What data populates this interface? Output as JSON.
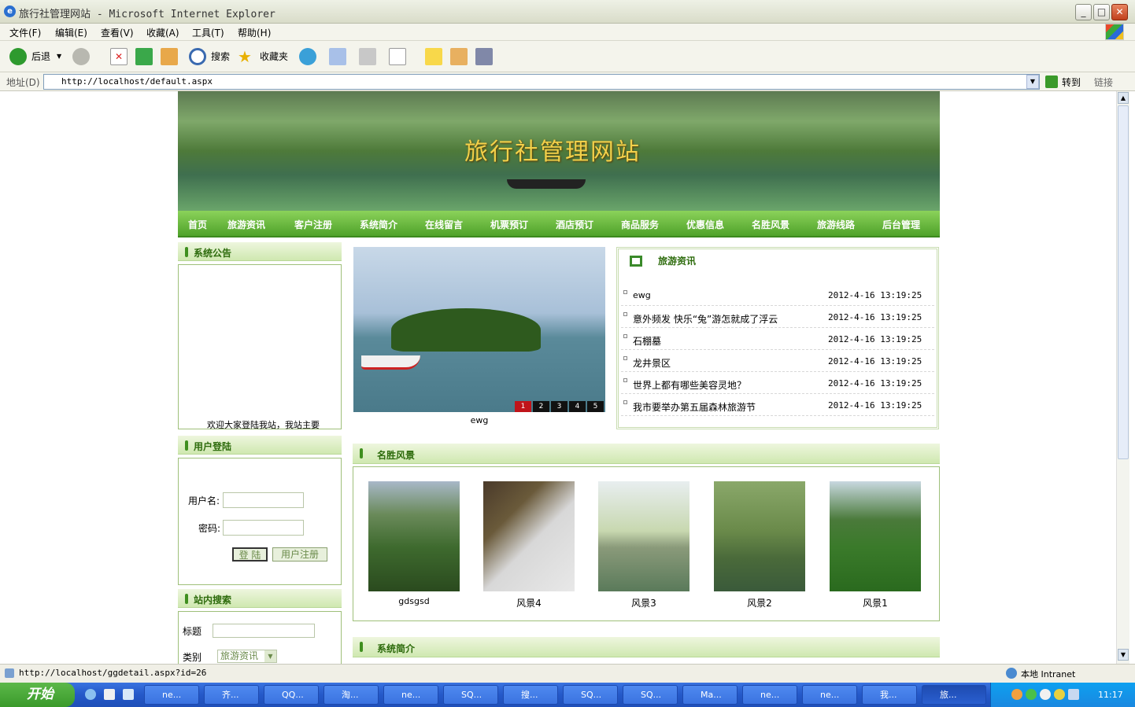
{
  "window": {
    "title": "旅行社管理网站 - Microsoft Internet Explorer",
    "minimize": "_",
    "maximize": "□",
    "close": "✕"
  },
  "menu": [
    "文件(F)",
    "编辑(E)",
    "查看(V)",
    "收藏(A)",
    "工具(T)",
    "帮助(H)"
  ],
  "toolbar": {
    "back": "后退",
    "search": "搜索",
    "favorites": "收藏夹"
  },
  "address": {
    "label": "地址(D)",
    "url": "http://localhost/default.aspx",
    "go": "转到",
    "links": "链接"
  },
  "site": {
    "banner_title": "旅行社管理网站",
    "nav": [
      "首页",
      "旅游资讯",
      "客户注册",
      "系统简介",
      "在线留言",
      "机票预订",
      "酒店预订",
      "商品服务",
      "优惠信息",
      "名胜风景",
      "旅游线路",
      "后台管理"
    ],
    "notice": {
      "title": "系统公告",
      "marquee": "欢迎大家登陆我站，我站主要"
    },
    "login": {
      "title": "用户登陆",
      "user_label": "用户名:",
      "pass_label": "密码:",
      "login_btn": "登 陆",
      "register_btn": "用户注册"
    },
    "search": {
      "title": "站内搜索",
      "title_label": "标题",
      "type_label": "类别",
      "type_value": "旅游资讯"
    },
    "slideshow": {
      "caption": "ewg",
      "pages": [
        "1",
        "2",
        "3",
        "4",
        "5"
      ],
      "active": 1
    },
    "news": {
      "title": "旅游资讯",
      "items": [
        {
          "title": "ewg",
          "date": "2012-4-16 13:19:25"
        },
        {
          "title": "意外频发 快乐“兔”游怎就成了浮云",
          "date": "2012-4-16 13:19:25"
        },
        {
          "title": "石棚墓",
          "date": "2012-4-16 13:19:25"
        },
        {
          "title": "龙井景区",
          "date": "2012-4-16 13:19:25"
        },
        {
          "title": "世界上都有哪些美容灵地？",
          "date": "2012-4-16 13:19:25"
        },
        {
          "title": "我市要举办第五届森林旅游节",
          "date": "2012-4-16 13:19:25"
        }
      ]
    },
    "scenery": {
      "title": "名胜风景",
      "items": [
        "gdsgsd",
        "风景4",
        "风景3",
        "风景2",
        "风景1"
      ]
    },
    "intro": {
      "title": "系统简介"
    }
  },
  "status": {
    "url": "http://localhost/ggdetail.aspx?id=26",
    "zone": "本地 Intranet"
  },
  "taskbar": {
    "start": "开始",
    "tasks": [
      "ne...",
      "齐...",
      "QQ...",
      "淘...",
      "ne...",
      "SQ...",
      "搜...",
      "SQ...",
      "SQ...",
      "Ma...",
      "ne...",
      "ne...",
      "我...",
      "旅..."
    ],
    "clock": "11:17"
  },
  "colors": {
    "nav_green": "#4fa22a",
    "header_text": "#2d6b0c",
    "banner_title": "#f2d04a"
  }
}
